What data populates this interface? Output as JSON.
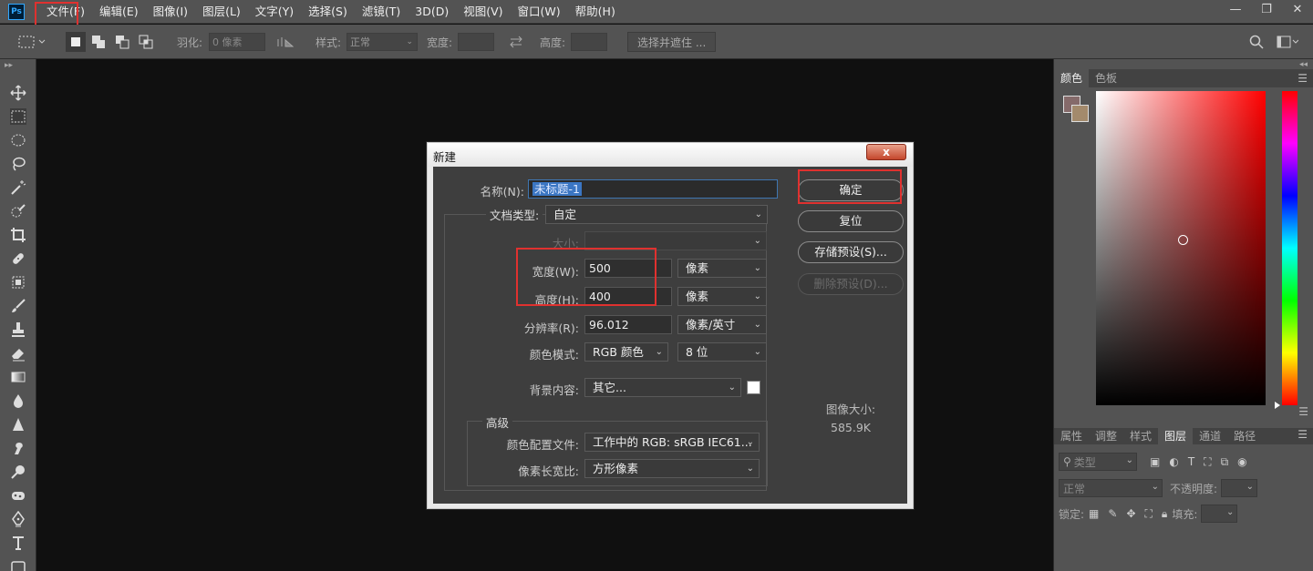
{
  "app": {
    "logo": "Ps"
  },
  "menu": [
    "文件(F)",
    "编辑(E)",
    "图像(I)",
    "图层(L)",
    "文字(Y)",
    "选择(S)",
    "滤镜(T)",
    "3D(D)",
    "视图(V)",
    "窗口(W)",
    "帮助(H)"
  ],
  "window_controls": [
    "—",
    "❐",
    "✕"
  ],
  "options": {
    "feather_label": "羽化:",
    "feather_value": "0 像素",
    "style_label": "样式:",
    "style_value": "正常",
    "width_label": "宽度:",
    "height_label": "高度:",
    "select_mask_button": "选择并遮住 ..."
  },
  "tools": [
    "move-tool-icon",
    "marquee-tool-icon",
    "ellipse-tool-icon",
    "lasso-tool-icon",
    "magic-wand-icon",
    "quick-select-icon",
    "crop-tool-icon",
    "healing-brush-icon",
    "patch-tool-icon",
    "brush-tool-icon",
    "stamp-tool-icon",
    "eraser-tool-icon",
    "gradient-tool-icon",
    "blur-tool-icon",
    "sharpen-tool-icon",
    "smudge-tool-icon",
    "dodge-tool-icon",
    "sponge-tool-icon",
    "pen-tool-icon",
    "type-tool-icon",
    "rectangle-tool-icon"
  ],
  "dialog": {
    "title": "新建",
    "close": "x",
    "name_label": "名称(N):",
    "name_value": "未标题-1",
    "doc_type_label": "文档类型:",
    "doc_type_value": "自定",
    "size_label": "大小:",
    "width_label": "宽度(W):",
    "width_value": "500",
    "width_unit": "像素",
    "height_label": "高度(H):",
    "height_value": "400",
    "height_unit": "像素",
    "resolution_label": "分辨率(R):",
    "resolution_value": "96.012",
    "resolution_unit": "像素/英寸",
    "color_mode_label": "颜色模式:",
    "color_mode_value": "RGB 颜色",
    "bit_depth_value": "8 位",
    "background_label": "背景内容:",
    "background_value": "其它...",
    "advanced_title": "高级",
    "color_profile_label": "颜色配置文件:",
    "color_profile_value": "工作中的 RGB: sRGB IEC61...",
    "pixel_aspect_label": "像素长宽比:",
    "pixel_aspect_value": "方形像素",
    "ok_button": "确定",
    "reset_button": "复位",
    "save_preset_button": "存储预设(S)...",
    "delete_preset_button": "删除预设(D)...",
    "image_size_label": "图像大小:",
    "image_size_value": "585.9K"
  },
  "color_panel": {
    "tabs": [
      "颜色",
      "色板"
    ],
    "foreground": "#856a6a",
    "background": "#a38a6c"
  },
  "layers_panel": {
    "tabs": [
      "属性",
      "调整",
      "样式",
      "图层",
      "通道",
      "路径"
    ],
    "active_tab": "图层",
    "filter_label": "类型",
    "blend_mode": "正常",
    "opacity_label": "不透明度:",
    "lock_label": "锁定:",
    "fill_label": "填充:"
  },
  "colors": {
    "highlight": "#e0312f",
    "accent": "#31a8ff"
  }
}
